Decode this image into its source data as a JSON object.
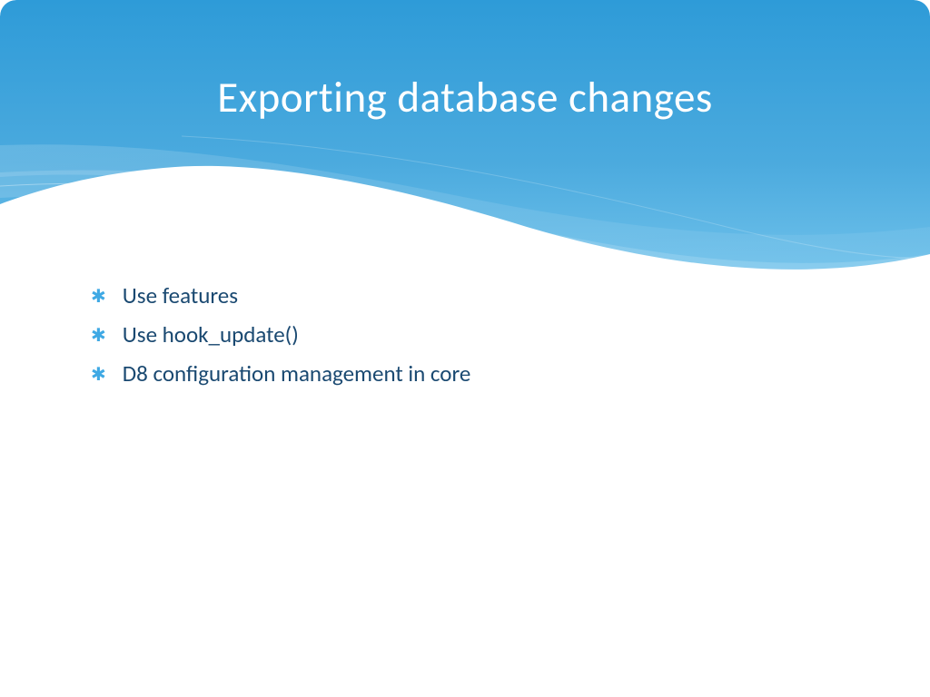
{
  "slide": {
    "title": "Exporting database changes",
    "bullets": [
      "Use features",
      "Use hook_update()",
      "D8 configuration management in core"
    ]
  },
  "colors": {
    "header_gradient_top": "#2e9bd8",
    "header_gradient_bottom": "#5eb7e6",
    "title_text": "#ffffff",
    "body_text": "#1a4971",
    "bullet_star": "#3fa9e4"
  }
}
